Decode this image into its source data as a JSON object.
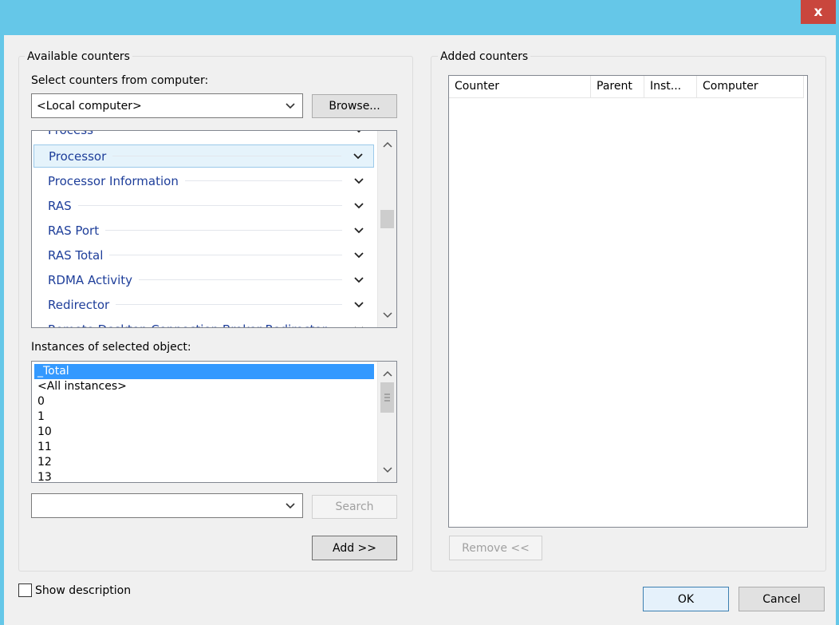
{
  "window": {
    "close_label": "x"
  },
  "available": {
    "group_label": "Available counters",
    "select_label": "Select counters from computer:",
    "computer_value": "<Local computer>",
    "browse_label": "Browse...",
    "objects": [
      {
        "name": "Process",
        "state": "partial"
      },
      {
        "name": "Processor",
        "state": "selected"
      },
      {
        "name": "Processor Information",
        "state": "normal"
      },
      {
        "name": "RAS",
        "state": "normal"
      },
      {
        "name": "RAS Port",
        "state": "normal"
      },
      {
        "name": "RAS Total",
        "state": "normal"
      },
      {
        "name": "RDMA Activity",
        "state": "normal"
      },
      {
        "name": "Redirector",
        "state": "normal"
      },
      {
        "name": "Remote Desktop Connection Broker Redirector",
        "state": "partial"
      }
    ],
    "instances_label": "Instances of selected object:",
    "instances": [
      "_Total",
      "<All instances>",
      "0",
      "1",
      "10",
      "11",
      "12",
      "13"
    ],
    "search_value": "",
    "search_label": "Search",
    "add_label": "Add >>"
  },
  "added": {
    "group_label": "Added counters",
    "columns": [
      "Counter",
      "Parent",
      "Inst...",
      "Computer"
    ],
    "remove_label": "Remove <<"
  },
  "footer": {
    "show_description_label": "Show description",
    "show_description_checked": false,
    "ok_label": "OK",
    "cancel_label": "Cancel"
  }
}
